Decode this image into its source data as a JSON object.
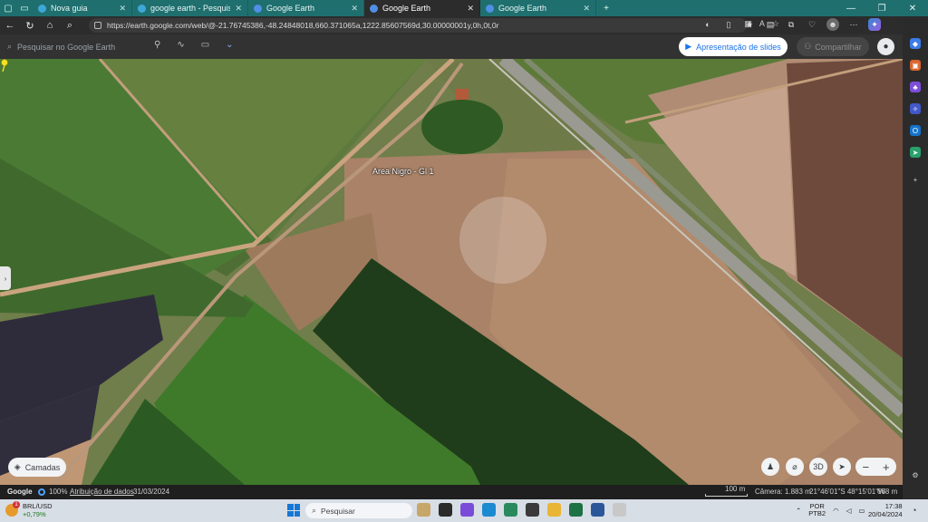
{
  "browser": {
    "tabs": [
      {
        "label": "Nova guia",
        "active": false,
        "icon": "edge-newtab-icon"
      },
      {
        "label": "google earth - Pesquisar",
        "active": false,
        "icon": "bing-search-icon"
      },
      {
        "label": "Google Earth",
        "active": false,
        "icon": "google-earth-icon"
      },
      {
        "label": "Google Earth",
        "active": true,
        "icon": "google-earth-icon"
      },
      {
        "label": "Google Earth",
        "active": false,
        "icon": "google-earth-icon"
      }
    ],
    "new_tab": "+",
    "window_controls": {
      "minimize": "—",
      "maximize": "❐",
      "close": "✕"
    },
    "url": "https://earth.google.com/web/@-21.76745386,-48.24848018,660.371065a,1222.85607569d,30.00000001y,0h,0t,0r",
    "nav": {
      "back": "←",
      "reload": "↻",
      "home": "⌂",
      "search": "⌕"
    }
  },
  "earth": {
    "search_placeholder": "Pesquisar no Google Earth",
    "tool_icons": [
      "pin-icon",
      "path-icon",
      "keyboard-icon",
      "chevron-down-icon"
    ],
    "slides_button": "Apresentação de slides",
    "share_button": "Compartilhar",
    "placemark": {
      "label": "Area Nigro - Gl 1",
      "color": "#f4e025"
    },
    "layers_button": "Camadas",
    "view_3d": "3D",
    "zoom_out": "−",
    "zoom_in": "+"
  },
  "status": {
    "brand": "Google",
    "zoom_pct": "100%",
    "data_attribution": "Atribuição de dados",
    "imagery_date": "31/03/2024",
    "scale": "100 m",
    "camera": "Câmera: 1.883 m",
    "coords": "21°46'01\"S 48°15'01\"W",
    "elevation": "668 m"
  },
  "taskbar": {
    "weather_pair": "BRL/USD",
    "weather_change": "+0,79%",
    "weather_badge": "1",
    "search_placeholder": "Pesquisar",
    "lang": "POR",
    "lang_variant": "PTB2",
    "time": "17:38",
    "date": "20/04/2024"
  },
  "colors": {
    "tab_strip": "#1f6f6f",
    "accent_blue": "#1a73e8",
    "placemark_yellow": "#f4e025"
  }
}
